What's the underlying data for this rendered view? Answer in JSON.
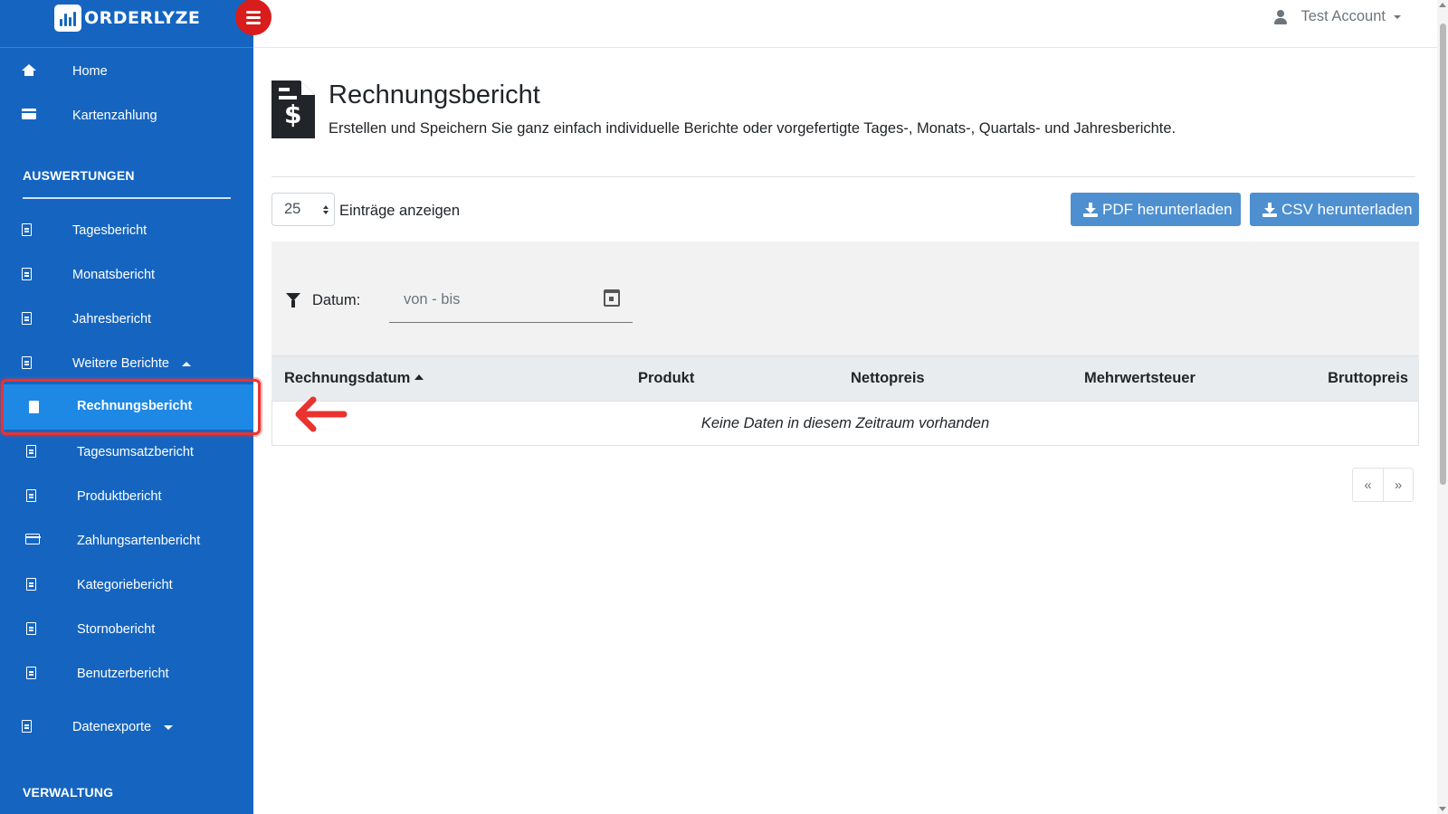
{
  "brand": {
    "name": "ORDERLYZE"
  },
  "account": {
    "name": "Test Account"
  },
  "sidebar": {
    "top_items": [
      {
        "label": "Home",
        "icon": "home-icon"
      },
      {
        "label": "Kartenzahlung",
        "icon": "credit-card-icon"
      }
    ],
    "sections": [
      {
        "title": "AUSWERTUNGEN"
      },
      {
        "title": "VERWALTUNG"
      }
    ],
    "report_items": [
      {
        "label": "Tagesbericht",
        "icon": "file-icon"
      },
      {
        "label": "Monatsbericht",
        "icon": "file-icon"
      },
      {
        "label": "Jahresbericht",
        "icon": "file-icon"
      },
      {
        "label": "Weitere Berichte",
        "icon": "file-icon",
        "expanded": true
      }
    ],
    "sub_items": [
      {
        "label": "Rechnungsbericht",
        "active": true
      },
      {
        "label": "Tagesumsatzbericht"
      },
      {
        "label": "Produktbericht"
      },
      {
        "label": "Zahlungsartenbericht"
      },
      {
        "label": "Kategoriebericht"
      },
      {
        "label": "Stornobericht"
      },
      {
        "label": "Benutzerbericht"
      }
    ],
    "exports": {
      "label": "Datenexporte",
      "expanded": false
    }
  },
  "page": {
    "title": "Rechnungsbericht",
    "subtitle": "Erstellen und Speichern Sie ganz einfach individuelle Berichte oder vorgefertigte Tages-, Monats-, Quartals- und Jahresberichte."
  },
  "controls": {
    "page_length": "25",
    "page_length_label": "Einträge anzeigen",
    "pdf_button": "PDF herunterladen",
    "csv_button": "CSV herunterladen"
  },
  "filter": {
    "label": "Datum:",
    "date_placeholder": "von - bis"
  },
  "table": {
    "columns": [
      "Rechnungsdatum",
      "Produkt",
      "Nettopreis",
      "Mehrwertsteuer",
      "Bruttopreis"
    ],
    "sorted_column": "Rechnungsdatum",
    "sort_direction": "ascending",
    "empty_message": "Keine Daten in diesem Zeitraum vorhanden"
  },
  "pagination": {
    "prev": "«",
    "next": "»"
  },
  "colors": {
    "sidebar": "#1565c0",
    "sidebar_active": "#1e88e5",
    "toggle": "#d91c1c",
    "button": "#4e8fd0",
    "highlight": "#e8332f"
  }
}
